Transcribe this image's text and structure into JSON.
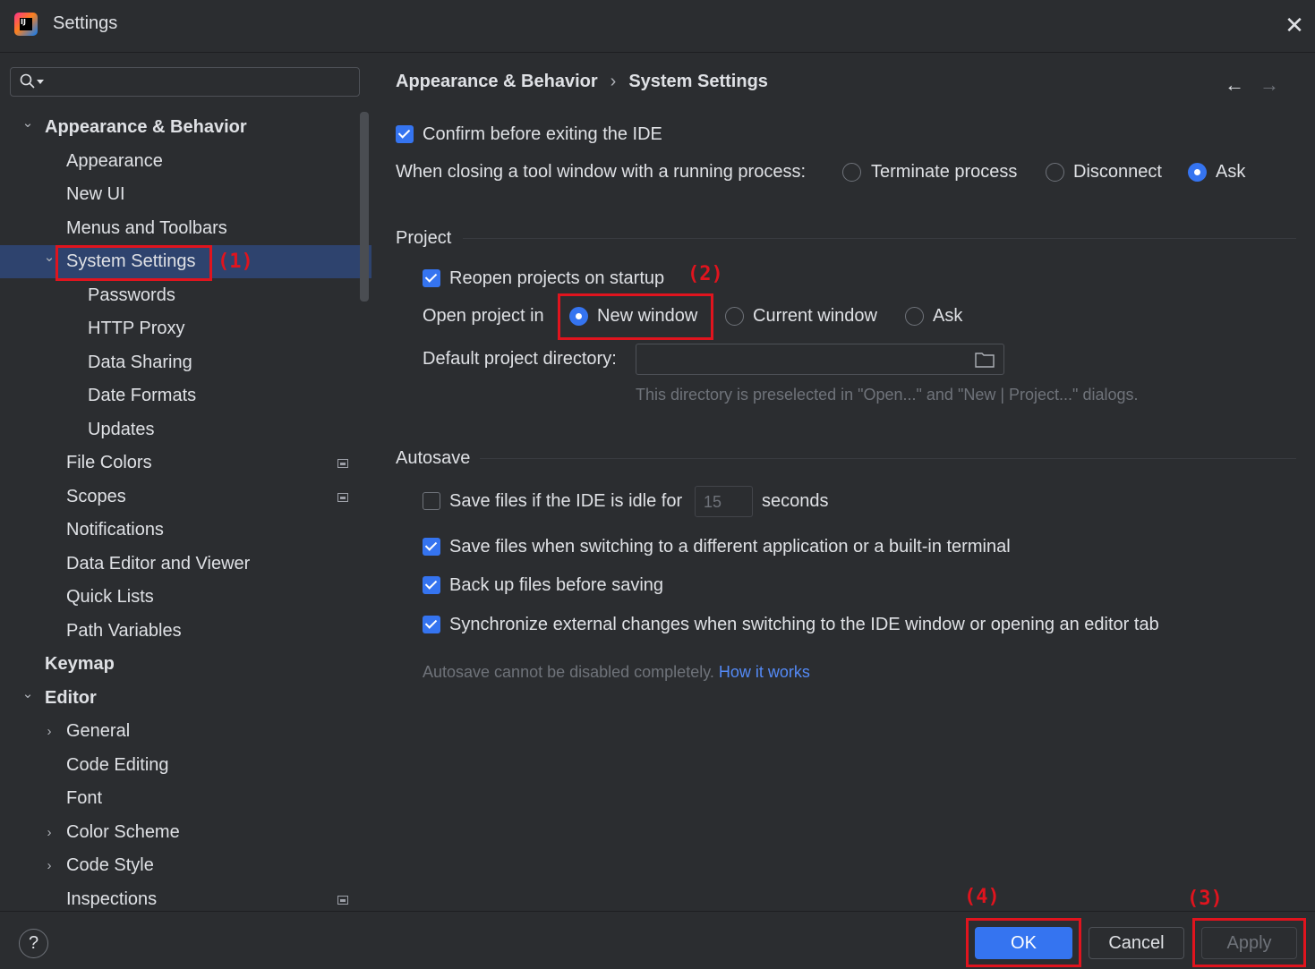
{
  "window": {
    "title": "Settings"
  },
  "search": {
    "placeholder": ""
  },
  "sidebar": {
    "items": [
      {
        "label": "Appearance & Behavior",
        "level": 0,
        "expanded": true,
        "bold": true
      },
      {
        "label": "Appearance",
        "level": 1
      },
      {
        "label": "New UI",
        "level": 1
      },
      {
        "label": "Menus and Toolbars",
        "level": 1
      },
      {
        "label": "System Settings",
        "level": 1,
        "expanded": true,
        "selected": true
      },
      {
        "label": "Passwords",
        "level": 2
      },
      {
        "label": "HTTP Proxy",
        "level": 2
      },
      {
        "label": "Data Sharing",
        "level": 2
      },
      {
        "label": "Date Formats",
        "level": 2
      },
      {
        "label": "Updates",
        "level": 2
      },
      {
        "label": "File Colors",
        "level": 1,
        "project_icon": true
      },
      {
        "label": "Scopes",
        "level": 1,
        "project_icon": true
      },
      {
        "label": "Notifications",
        "level": 1
      },
      {
        "label": "Data Editor and Viewer",
        "level": 1
      },
      {
        "label": "Quick Lists",
        "level": 1
      },
      {
        "label": "Path Variables",
        "level": 1
      },
      {
        "label": "Keymap",
        "level": 0,
        "bold": true
      },
      {
        "label": "Editor",
        "level": 0,
        "expanded": true,
        "bold": true
      },
      {
        "label": "General",
        "level": 1,
        "collapsed": true
      },
      {
        "label": "Code Editing",
        "level": 1
      },
      {
        "label": "Font",
        "level": 1
      },
      {
        "label": "Color Scheme",
        "level": 1,
        "collapsed": true
      },
      {
        "label": "Code Style",
        "level": 1,
        "collapsed": true
      },
      {
        "label": "Inspections",
        "level": 1,
        "project_icon": true
      }
    ]
  },
  "breadcrumb": {
    "parent": "Appearance & Behavior",
    "separator": "›",
    "current": "System Settings"
  },
  "nav": {
    "back": "←",
    "forward": "→"
  },
  "general": {
    "confirm_exit_label": "Confirm before exiting the IDE",
    "confirm_exit_checked": true,
    "closing_tool_label": "When closing a tool window with a running process:",
    "closing_options": [
      "Terminate process",
      "Disconnect",
      "Ask"
    ],
    "closing_selected": "Ask"
  },
  "project": {
    "section_title": "Project",
    "reopen_label": "Reopen projects on startup",
    "reopen_checked": true,
    "open_in_label": "Open project in",
    "open_options": [
      "New window",
      "Current window",
      "Ask"
    ],
    "open_selected": "New window",
    "default_dir_label": "Default project directory:",
    "default_dir_value": "",
    "default_dir_hint": "This directory is preselected in \"Open...\" and \"New | Project...\" dialogs."
  },
  "autosave": {
    "section_title": "Autosave",
    "idle_label": "Save files if the IDE is idle for",
    "idle_checked": false,
    "idle_seconds": "15",
    "idle_unit": "seconds",
    "switch_label": "Save files when switching to a different application or a built-in terminal",
    "switch_checked": true,
    "backup_label": "Back up files before saving",
    "backup_checked": true,
    "sync_label": "Synchronize external changes when switching to the IDE window or opening an editor tab",
    "sync_checked": true,
    "note": "Autosave cannot be disabled completely.",
    "note_link": "How it works"
  },
  "annotations": {
    "a1": "(1)",
    "a2": "(2)",
    "a3": "(3)",
    "a4": "(4)"
  },
  "footer": {
    "help": "?",
    "ok": "OK",
    "cancel": "Cancel",
    "apply": "Apply"
  },
  "colors": {
    "accent": "#3574f0",
    "selection": "#2e436e",
    "highlight": "#e0141e",
    "link": "#548af7"
  }
}
